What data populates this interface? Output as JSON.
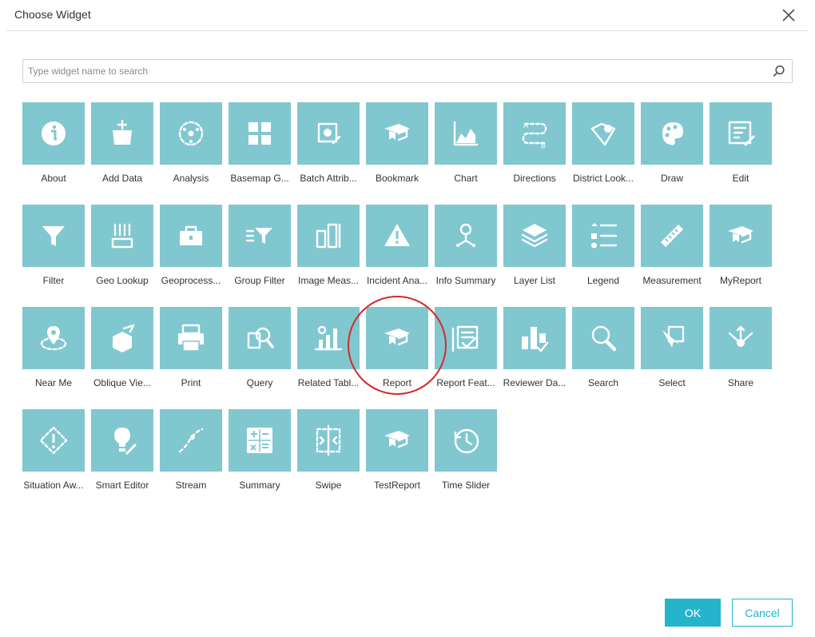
{
  "dialog": {
    "title": "Choose Widget",
    "close_label": "×"
  },
  "search": {
    "placeholder": "Type widget name to search",
    "value": ""
  },
  "widgets": [
    {
      "label": "About",
      "icon": "info-icon"
    },
    {
      "label": "Add Data",
      "icon": "add-data-icon"
    },
    {
      "label": "Analysis",
      "icon": "analysis-icon"
    },
    {
      "label": "Basemap G...",
      "icon": "basemap-gallery-icon"
    },
    {
      "label": "Batch Attrib...",
      "icon": "batch-attribute-editor-icon"
    },
    {
      "label": "Bookmark",
      "icon": "bookmark-icon"
    },
    {
      "label": "Chart",
      "icon": "chart-icon"
    },
    {
      "label": "Directions",
      "icon": "directions-icon"
    },
    {
      "label": "District Look...",
      "icon": "district-lookup-icon"
    },
    {
      "label": "Draw",
      "icon": "draw-icon"
    },
    {
      "label": "Edit",
      "icon": "edit-icon"
    },
    {
      "label": "Filter",
      "icon": "filter-icon"
    },
    {
      "label": "Geo Lookup",
      "icon": "geo-lookup-icon"
    },
    {
      "label": "Geoprocess...",
      "icon": "geoprocessing-icon"
    },
    {
      "label": "Group Filter",
      "icon": "group-filter-icon"
    },
    {
      "label": "Image Meas...",
      "icon": "image-measurement-icon"
    },
    {
      "label": "Incident Ana...",
      "icon": "incident-analysis-icon"
    },
    {
      "label": "Info Summary",
      "icon": "info-summary-icon"
    },
    {
      "label": "Layer List",
      "icon": "layer-list-icon"
    },
    {
      "label": "Legend",
      "icon": "legend-icon"
    },
    {
      "label": "Measurement",
      "icon": "measurement-icon"
    },
    {
      "label": "MyReport",
      "icon": "report-icon"
    },
    {
      "label": "Near Me",
      "icon": "near-me-icon"
    },
    {
      "label": "Oblique Vie...",
      "icon": "oblique-viewer-icon"
    },
    {
      "label": "Print",
      "icon": "print-icon"
    },
    {
      "label": "Query",
      "icon": "query-icon"
    },
    {
      "label": "Related Tabl...",
      "icon": "related-table-charts-icon"
    },
    {
      "label": "Report",
      "icon": "report-icon"
    },
    {
      "label": "Report Feat...",
      "icon": "report-feature-icon"
    },
    {
      "label": "Reviewer Da...",
      "icon": "reviewer-dashboard-icon"
    },
    {
      "label": "Search",
      "icon": "search-icon"
    },
    {
      "label": "Select",
      "icon": "select-icon"
    },
    {
      "label": "Share",
      "icon": "share-icon"
    },
    {
      "label": "Situation Aw...",
      "icon": "situation-awareness-icon"
    },
    {
      "label": "Smart Editor",
      "icon": "smart-editor-icon"
    },
    {
      "label": "Stream",
      "icon": "stream-icon"
    },
    {
      "label": "Summary",
      "icon": "summary-icon"
    },
    {
      "label": "Swipe",
      "icon": "swipe-icon"
    },
    {
      "label": "TestReport",
      "icon": "report-icon"
    },
    {
      "label": "Time Slider",
      "icon": "time-slider-icon"
    }
  ],
  "highlighted_widget": "Report",
  "footer": {
    "ok_label": "OK",
    "cancel_label": "Cancel"
  },
  "colors": {
    "tile": "#81c7d0",
    "accent": "#24b5cc",
    "highlight": "#d42a2a"
  }
}
